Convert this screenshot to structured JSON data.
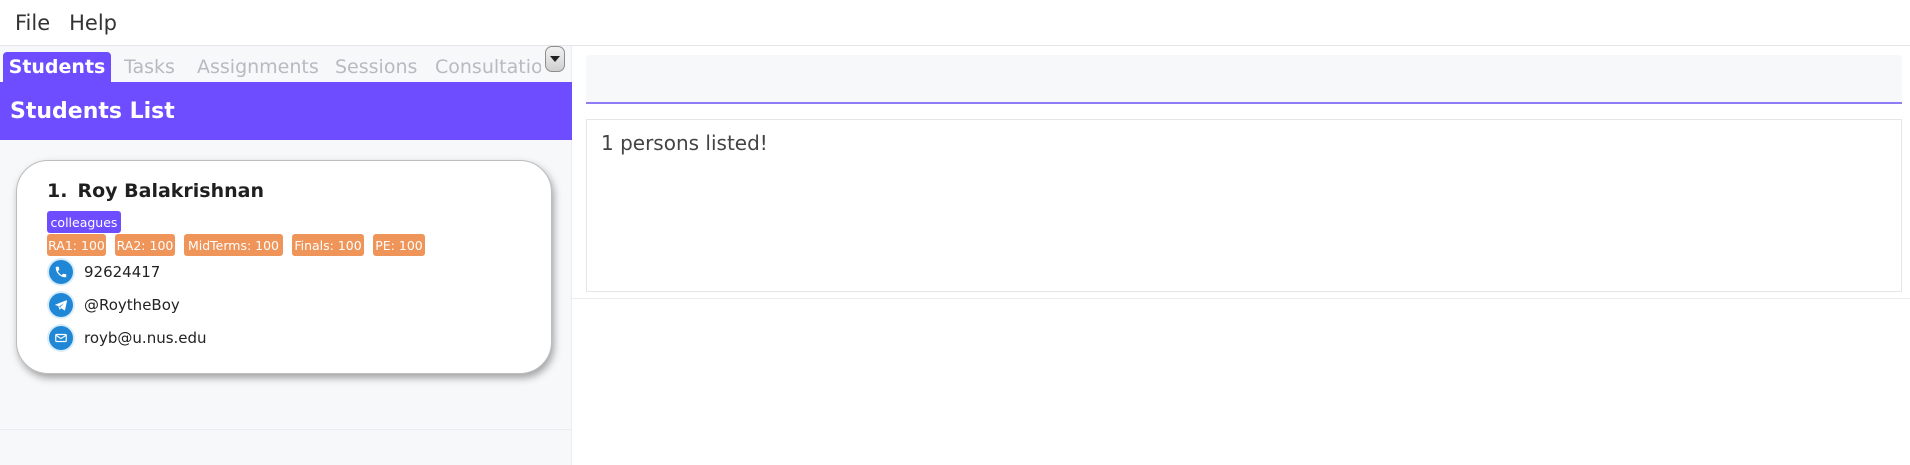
{
  "menu": {
    "file_label": "File",
    "help_label": "Help"
  },
  "tabs": [
    {
      "label": "Students"
    },
    {
      "label": "Tasks"
    },
    {
      "label": "Assignments"
    },
    {
      "label": "Sessions"
    },
    {
      "label": "Consultations"
    }
  ],
  "list": {
    "title": "Students List"
  },
  "student": {
    "index": "1.",
    "name": "Roy Balakrishnan",
    "group_tag": "colleagues",
    "grades": [
      "RA1: 100",
      "RA2: 100",
      "MidTerms: 100",
      "Finals: 100",
      "PE: 100"
    ],
    "phone": "92624417",
    "telegram": "@RoytheBoy",
    "email": "royb@u.nus.edu"
  },
  "command": {
    "value": ""
  },
  "result": {
    "message": "1 persons listed!"
  },
  "colors": {
    "accent": "#6d4dff",
    "grade_tag": "#f0955a",
    "icon_blue": "#1f87d6"
  }
}
